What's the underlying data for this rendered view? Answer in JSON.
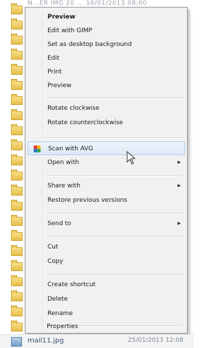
{
  "top_row": {
    "text": "N...ER IMG 20  ...  16/01/2013 08:00"
  },
  "menu": {
    "items": [
      {
        "label": "Preview"
      },
      {
        "label": "Edit with GIMP"
      },
      {
        "label": "Set as desktop background"
      },
      {
        "label": "Edit"
      },
      {
        "label": "Print"
      },
      {
        "label": "Preview"
      },
      {
        "label": "Rotate clockwise"
      },
      {
        "label": "Rotate counterclockwise"
      },
      {
        "label": "Scan with AVG"
      },
      {
        "label": "Open with"
      },
      {
        "label": "Share with"
      },
      {
        "label": "Restore previous versions"
      },
      {
        "label": "Send to"
      },
      {
        "label": "Cut"
      },
      {
        "label": "Copy"
      },
      {
        "label": "Create shortcut"
      },
      {
        "label": "Delete"
      },
      {
        "label": "Rename"
      },
      {
        "label": "Properties"
      }
    ],
    "submenu_arrow": "▶"
  },
  "bottom_row": {
    "name": "mail11.jpg",
    "date": "25/01/2013 12:08"
  },
  "colors": {
    "menu_bg": "#f1f1f1",
    "hover_bg": "#dde9f7",
    "hover_border": "#aecbee",
    "folder": "#e6bf4a"
  },
  "icons": [
    "folder-icon",
    "avg-icon",
    "submenu-arrow-icon",
    "mouse-cursor-icon",
    "image-file-icon"
  ]
}
